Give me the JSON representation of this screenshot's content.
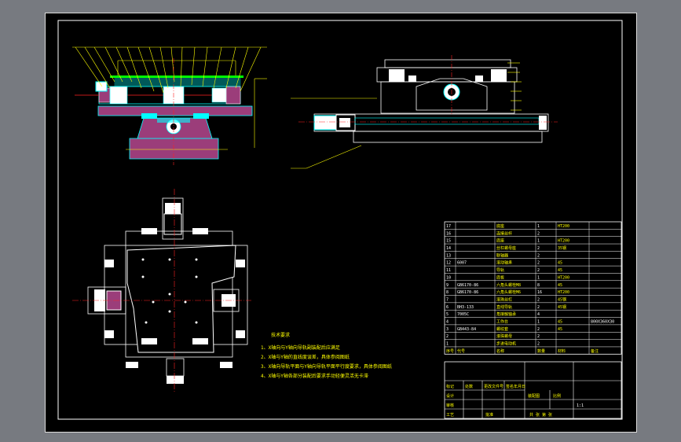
{
  "tech_requirements": {
    "title": "技术要求",
    "items": [
      "1、X轴向与Y轴向导轨副装配后应满足",
      "2、X轴与Y轴的直线度误差，具体参阅图纸",
      "3、X轴向导轨平面与Y轴向导轨平面平行度要求，具体参阅图纸",
      "4、X轴与Y轴各部分装配后要求手动轻便灵活无卡滞"
    ]
  },
  "bom": {
    "rows": [
      {
        "no": "17",
        "code": "",
        "name": "底座",
        "qty": "1",
        "material": "HT200",
        "note": ""
      },
      {
        "no": "16",
        "code": "",
        "name": "连接丝杆",
        "qty": "2",
        "material": "",
        "note": ""
      },
      {
        "no": "15",
        "code": "",
        "name": "底座",
        "qty": "1",
        "material": "HT200",
        "note": ""
      },
      {
        "no": "14",
        "code": "",
        "name": "丝杠螺母座",
        "qty": "2",
        "material": "35钢",
        "note": ""
      },
      {
        "no": "13",
        "code": "",
        "name": "联轴器",
        "qty": "2",
        "material": "",
        "note": ""
      },
      {
        "no": "12",
        "code": "6007",
        "name": "滚动轴承",
        "qty": "2",
        "material": "45",
        "note": ""
      },
      {
        "no": "11",
        "code": "",
        "name": "导轨",
        "qty": "2",
        "material": "45",
        "note": ""
      },
      {
        "no": "10",
        "code": "",
        "name": "底板",
        "qty": "1",
        "material": "HT200",
        "note": ""
      },
      {
        "no": "9",
        "code": "GB6170-86",
        "name": "六角头螺栓M8",
        "qty": "8",
        "material": "45",
        "note": ""
      },
      {
        "no": "8",
        "code": "GB6170-86",
        "name": "六角头螺栓M6",
        "qty": "16",
        "material": "HT200",
        "note": ""
      },
      {
        "no": "7",
        "code": "",
        "name": "滚珠丝杠",
        "qty": "2",
        "material": "45钢",
        "note": ""
      },
      {
        "no": "6",
        "code": "BH3-133",
        "name": "直线导轨",
        "qty": "2",
        "material": "45钢",
        "note": ""
      },
      {
        "no": "5",
        "code": "7005C",
        "name": "角接触轴承",
        "qty": "4",
        "material": "",
        "note": ""
      },
      {
        "no": "4",
        "code": "",
        "name": "工作台",
        "qty": "1",
        "material": "45",
        "note": "800X360X30"
      },
      {
        "no": "3",
        "code": "GB443-84",
        "name": "螺纹套",
        "qty": "2",
        "material": "45",
        "note": ""
      },
      {
        "no": "2",
        "code": "",
        "name": "滚珠螺母",
        "qty": "2",
        "material": "",
        "note": ""
      },
      {
        "no": "1",
        "code": "",
        "name": "步进电动机",
        "qty": "2",
        "material": "",
        "note": ""
      }
    ],
    "header": [
      "序号",
      "代号",
      "名称",
      "数量",
      "材料",
      "备注"
    ]
  },
  "title_block": {
    "labels": [
      "标记",
      "处数",
      "更改文件号",
      "签名",
      "年月日"
    ],
    "design": "设计",
    "check": "审核",
    "process": "工艺",
    "approve": "批准",
    "drawing_title": "装配图",
    "scale_label": "比例",
    "scale": "1:1",
    "sheet": "共 张 第 张"
  },
  "colors": {
    "frame": "#ffffff",
    "outline": "#00ffff",
    "part": "#9b3d7a",
    "dim": "#ffff00",
    "center": "#ff2020",
    "green": "#00ff00"
  }
}
